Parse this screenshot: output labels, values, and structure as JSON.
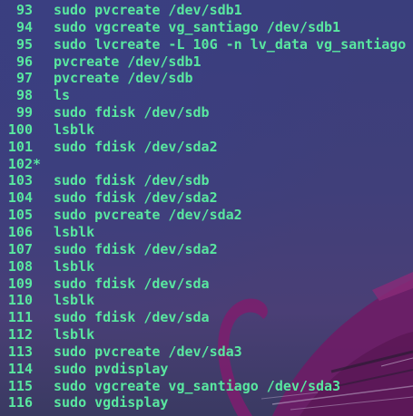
{
  "terminal": {
    "history": [
      {
        "num": "93",
        "mark": "",
        "cmd": "sudo pvcreate /dev/sdb1"
      },
      {
        "num": "94",
        "mark": "",
        "cmd": "sudo vgcreate vg_santiago /dev/sdb1"
      },
      {
        "num": "95",
        "mark": "",
        "cmd": "sudo lvcreate -L 10G -n lv_data vg_santiago"
      },
      {
        "num": "96",
        "mark": "",
        "cmd": "pvcreate /dev/sdb1"
      },
      {
        "num": "97",
        "mark": "",
        "cmd": "pvcreate /dev/sdb"
      },
      {
        "num": "98",
        "mark": "",
        "cmd": "ls"
      },
      {
        "num": "99",
        "mark": "",
        "cmd": "sudo fdisk /dev/sdb"
      },
      {
        "num": "100",
        "mark": "",
        "cmd": "lsblk"
      },
      {
        "num": "101",
        "mark": "",
        "cmd": "sudo fdisk /dev/sda2"
      },
      {
        "num": "102",
        "mark": "*",
        "cmd": ""
      },
      {
        "num": "103",
        "mark": "",
        "cmd": "sudo fdisk /dev/sdb"
      },
      {
        "num": "104",
        "mark": "",
        "cmd": "sudo fdisk /dev/sda2"
      },
      {
        "num": "105",
        "mark": "",
        "cmd": "sudo pvcreate /dev/sda2"
      },
      {
        "num": "106",
        "mark": "",
        "cmd": "lsblk"
      },
      {
        "num": "107",
        "mark": "",
        "cmd": "sudo fdisk /dev/sda2"
      },
      {
        "num": "108",
        "mark": "",
        "cmd": "lsblk"
      },
      {
        "num": "109",
        "mark": "",
        "cmd": "sudo fdisk /dev/sda"
      },
      {
        "num": "110",
        "mark": "",
        "cmd": "lsblk"
      },
      {
        "num": "111",
        "mark": "",
        "cmd": "sudo fdisk /dev/sda"
      },
      {
        "num": "112",
        "mark": "",
        "cmd": "lsblk"
      },
      {
        "num": "113",
        "mark": "",
        "cmd": "sudo pvcreate /dev/sda3"
      },
      {
        "num": "114",
        "mark": "",
        "cmd": "sudo pvdisplay"
      },
      {
        "num": "115",
        "mark": "",
        "cmd": "sudo vgcreate vg_santiago /dev/sda3"
      },
      {
        "num": "116",
        "mark": "",
        "cmd": "sudo vgdisplay"
      }
    ]
  },
  "colors": {
    "text": "#59e8a0",
    "background": "#3b3f78",
    "wallpaper_dragon": "#7a1f6e"
  }
}
